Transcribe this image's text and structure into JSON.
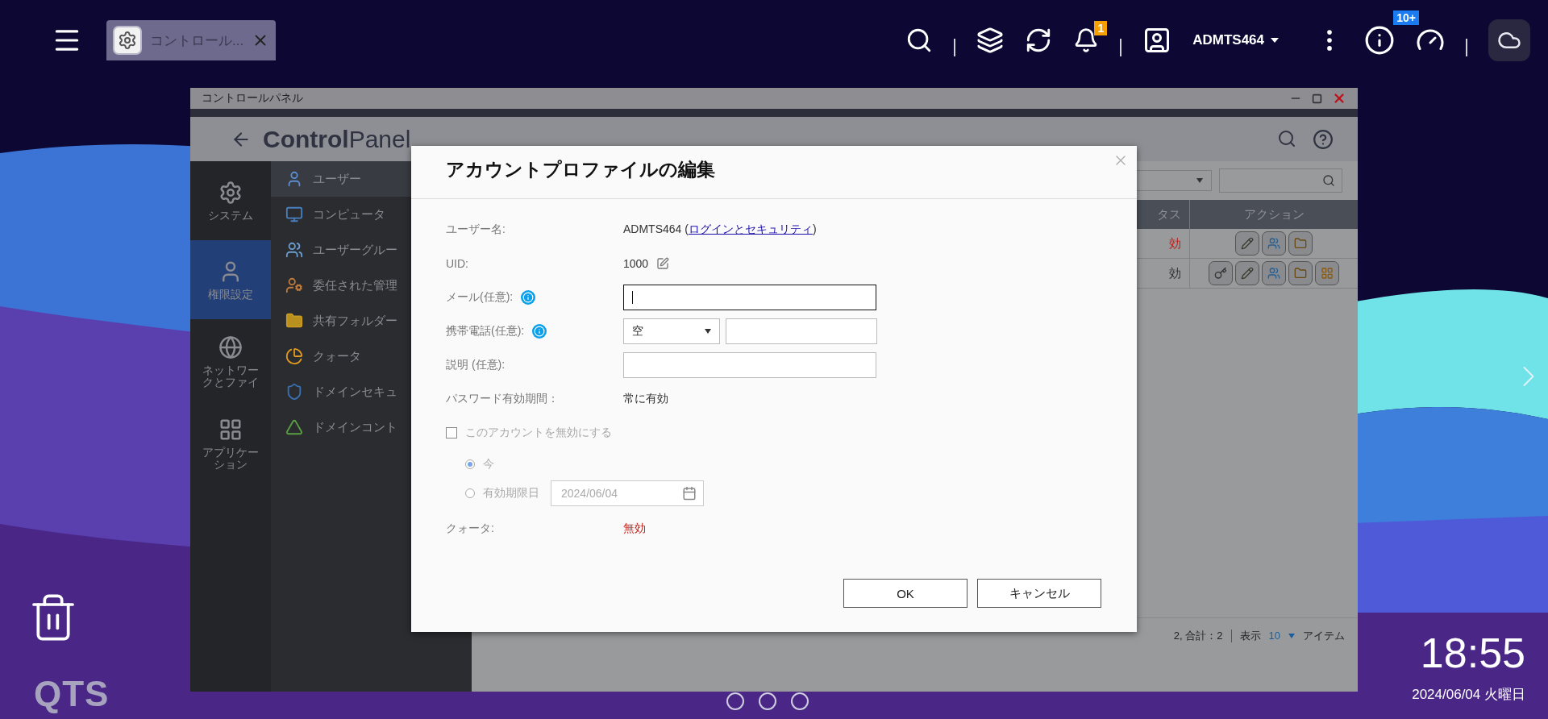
{
  "taskbar": {
    "tabs": [
      {
        "label": "コントロール...",
        "selected": true
      }
    ],
    "notification_badge": "1",
    "user": "ADMTS464",
    "info_badge": "10+"
  },
  "window": {
    "title": "コントロールパネル",
    "app_title": "**Control**Panel"
  },
  "nav": [
    {
      "kind": "system",
      "label": "システム",
      "selected": false
    },
    {
      "kind": "privilege",
      "label": "権限設定",
      "selected": true
    },
    {
      "kind": "network",
      "label": "ネットワークとファイ",
      "selected": false
    },
    {
      "kind": "apps",
      "label": "アプリケーション",
      "selected": false
    }
  ],
  "subnav": [
    {
      "kind": "user",
      "label": "ユーザー",
      "selected": true
    },
    {
      "kind": "computer",
      "label": "コンピュータ",
      "selected": false
    },
    {
      "kind": "group",
      "label": "ユーザーグルー",
      "selected": false
    },
    {
      "kind": "delegate",
      "label": "委任された管理",
      "selected": false
    },
    {
      "kind": "folder",
      "label": "共有フォルダー",
      "selected": false
    },
    {
      "kind": "quota",
      "label": "クォータ",
      "selected": false
    },
    {
      "kind": "domain-security",
      "label": "ドメインセキュ",
      "selected": false
    },
    {
      "kind": "domain-controller",
      "label": "ドメインコント",
      "selected": false
    }
  ],
  "table": {
    "columns": [
      "タス",
      "アクション"
    ],
    "rows": [
      {
        "column_1": "効",
        "color": "#c0201a",
        "actions": [
          {
            "kind": "edit"
          },
          {
            "kind": "group"
          },
          {
            "kind": "folder"
          }
        ]
      },
      {
        "column_1": "効",
        "color": "#333333",
        "actions": [
          {
            "kind": "key"
          },
          {
            "kind": "edit"
          },
          {
            "kind": "group"
          },
          {
            "kind": "folder"
          },
          {
            "kind": "apps"
          }
        ]
      }
    ]
  },
  "footer": {
    "summary": "2, 合計：2",
    "show_label": "表示",
    "page_size": "10",
    "unit": "アイテム"
  },
  "dialog": {
    "title": "アカウントプロファイルの編集",
    "fields": [
      {
        "kind": "link-text",
        "label": "ユーザー名:",
        "value": "ADMTS464 (",
        "link": "ログインとセキュリティ",
        "value_end": ")"
      },
      {
        "kind": "editable",
        "label": "UID:",
        "value": "1000"
      },
      {
        "kind": "input",
        "label": "メール(任意):",
        "info": true,
        "focused": true
      },
      {
        "kind": "phone",
        "label": "携帯電話(任意):",
        "info": true,
        "country": "空"
      },
      {
        "kind": "input",
        "label": "説明 (任意):",
        "info": false,
        "focused": false
      },
      {
        "kind": "text",
        "label": "パスワード有効期間：",
        "value": "常に有効"
      }
    ],
    "disable_account": {
      "label": "このアカウントを無効にする",
      "checked": false,
      "disabled": true
    },
    "expiry_options": [
      {
        "label": "今",
        "selected": true
      },
      {
        "label": "有効期限日",
        "selected": false,
        "date": "2024/06/04"
      }
    ],
    "quota": {
      "label": "クォータ:",
      "value": "無効"
    },
    "buttons": [
      "OK",
      "キャンセル"
    ]
  },
  "desktop": {
    "logo": "QTS",
    "clock": "18:55",
    "date": "2024/06/04 火曜日"
  }
}
